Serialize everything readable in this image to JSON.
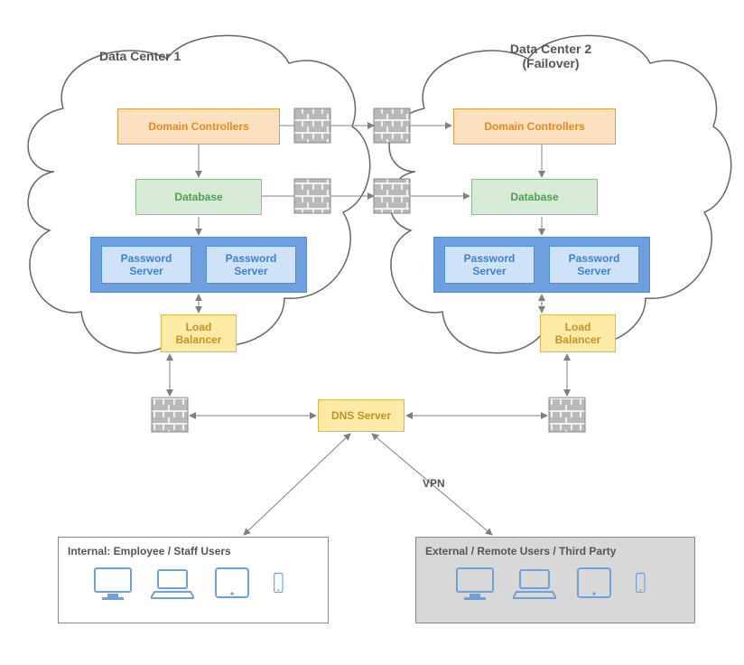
{
  "dc1": {
    "title": "Data Center 1"
  },
  "dc2": {
    "title1": "Data Center 2",
    "title2": "(Failover)"
  },
  "nodes": {
    "domain_controllers": "Domain Controllers",
    "database": "Database",
    "password_server": "Password Server",
    "load_balancer": "Load Balancer",
    "dns_server": "DNS Server"
  },
  "users": {
    "internal": "Internal: Employee / Staff Users",
    "external": "External / Remote Users / Third Party"
  },
  "labels": {
    "vpn": "VPN"
  },
  "colors": {
    "orange_border": "#e89c3c",
    "orange_fill": "#fce1c0",
    "orange_text": "#e68a1b",
    "green_border": "#8fc08f",
    "green_fill": "#d6ead6",
    "green_text": "#4f9e4f",
    "blue_border": "#4a90d9",
    "blue_fill": "#d0e2f7",
    "blue_text": "#3b82d4",
    "blue_dark_fill": "#6ea0e0",
    "yellow_border": "#e6b839",
    "yellow_fill": "#fdeaa7",
    "yellow_text": "#c49324",
    "gray_line": "#808080",
    "gray_arrow": "#808080",
    "firewall_light": "#f0f0f0",
    "firewall_dark": "#b9b9b9",
    "cloud_stroke": "#666",
    "label_dark": "#555",
    "device_stroke": "#6ea0e0",
    "ext_bg": "#d8d8d8"
  }
}
